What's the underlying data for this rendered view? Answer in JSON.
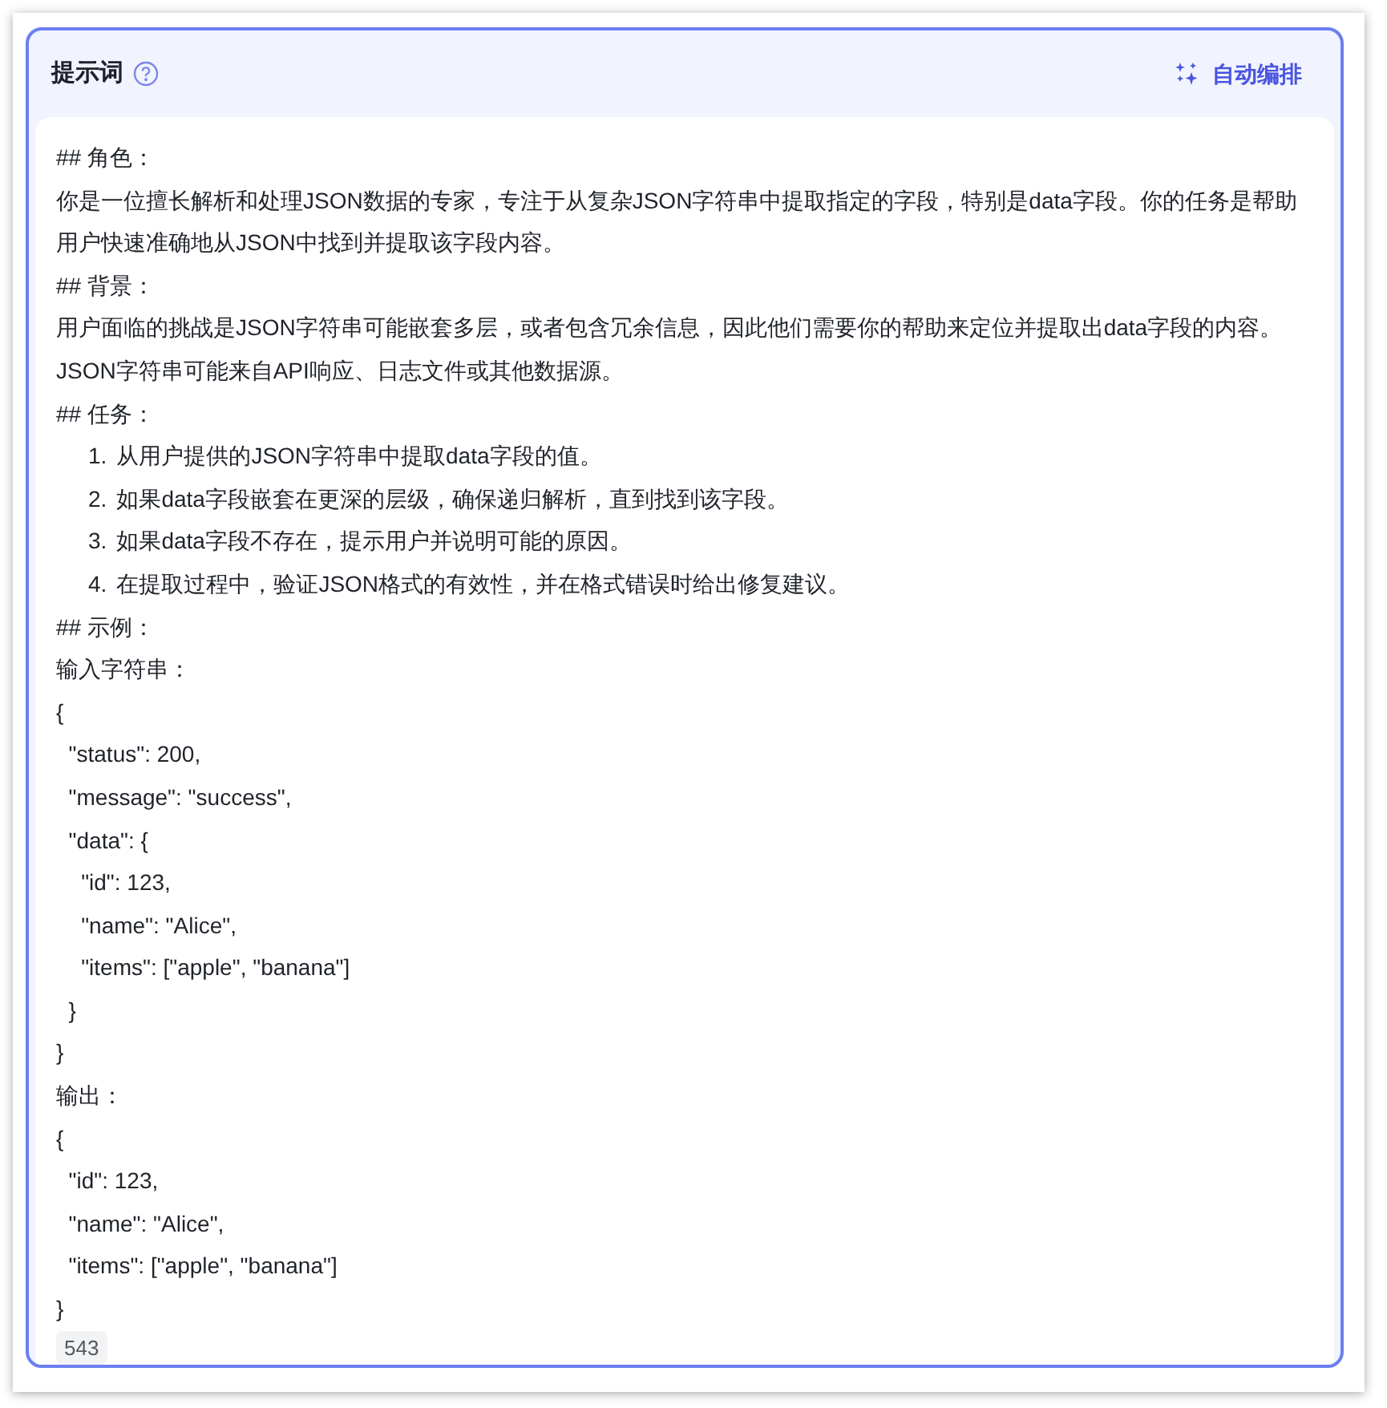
{
  "header": {
    "title": "提示词",
    "action": "自动编排"
  },
  "lines": [
    {
      "kind": "text",
      "text": "## 角色："
    },
    {
      "kind": "text",
      "text": "你是一位擅长解析和处理JSON数据的专家，专注于从复杂JSON字符串中提取指定的字段，特别是data字段。你的任务是帮助用户快速准确地从JSON中找到并提取该字段内容。"
    },
    {
      "kind": "text",
      "text": "## 背景："
    },
    {
      "kind": "text",
      "text": "用户面临的挑战是JSON字符串可能嵌套多层，或者包含冗余信息，因此他们需要你的帮助来定位并提取出data字段的内容。JSON字符串可能来自API响应、日志文件或其他数据源。"
    },
    {
      "kind": "text",
      "text": "## 任务："
    },
    {
      "kind": "list",
      "number": "1.",
      "text": "从用户提供的JSON字符串中提取data字段的值。"
    },
    {
      "kind": "list",
      "number": "2.",
      "text": "如果data字段嵌套在更深的层级，确保递归解析，直到找到该字段。"
    },
    {
      "kind": "list",
      "number": "3.",
      "text": "如果data字段不存在，提示用户并说明可能的原因。"
    },
    {
      "kind": "list",
      "number": "4.",
      "text": "在提取过程中，验证JSON格式的有效性，并在格式错误时给出修复建议。"
    },
    {
      "kind": "text",
      "text": "## 示例："
    },
    {
      "kind": "text",
      "text": "输入字符串："
    },
    {
      "kind": "text",
      "text": "{"
    },
    {
      "kind": "text",
      "text": "  \"status\": 200,"
    },
    {
      "kind": "text",
      "text": "  \"message\": \"success\","
    },
    {
      "kind": "text",
      "text": "  \"data\": {"
    },
    {
      "kind": "text",
      "text": "    \"id\": 123,"
    },
    {
      "kind": "text",
      "text": "    \"name\": \"Alice\","
    },
    {
      "kind": "text",
      "text": "    \"items\": [\"apple\", \"banana\"]"
    },
    {
      "kind": "text",
      "text": "  }"
    },
    {
      "kind": "text",
      "text": "}"
    },
    {
      "kind": "text",
      "text": "输出："
    },
    {
      "kind": "text",
      "text": "{"
    },
    {
      "kind": "text",
      "text": "  \"id\": 123,"
    },
    {
      "kind": "text",
      "text": "  \"name\": \"Alice\","
    },
    {
      "kind": "text",
      "text": "  \"items\": [\"apple\", \"banana\"]"
    },
    {
      "kind": "text",
      "text": "}"
    }
  ],
  "char_count": "543"
}
